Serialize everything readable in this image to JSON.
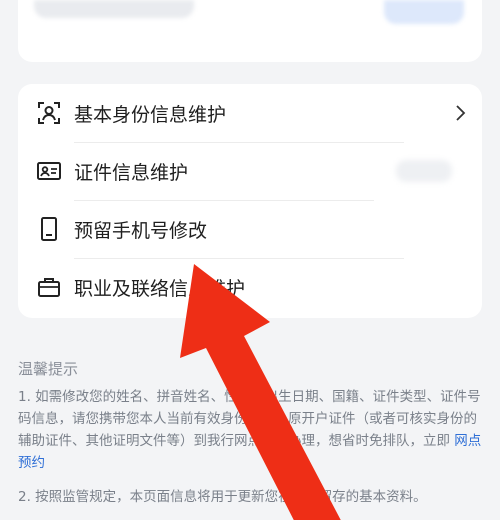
{
  "menu": {
    "items": [
      {
        "label": "基本身份信息维护",
        "icon": "id-person-icon"
      },
      {
        "label": "证件信息维护",
        "icon": "id-card-icon"
      },
      {
        "label": "预留手机号修改",
        "icon": "phone-icon"
      },
      {
        "label": "职业及联络信息维护",
        "icon": "briefcase-icon"
      }
    ]
  },
  "tips": {
    "title": "温馨提示",
    "p1_text": "1. 如需修改您的姓名、拼音姓名、性别、出生日期、国籍、证件类型、证件号码信息，请您携带您本人当前有效身份证件、原开户证件（或者可核实身份的辅助证件、其他证明文件等）到我行网点咨询办理，想省时免排队，立即",
    "p1_link": "网点预约",
    "p2_text": "2. 按照监管规定，本页面信息将用于更新您在我行留存的基本资料。"
  },
  "colors": {
    "arrow": "#ee2e16",
    "link": "#2f6fd6"
  }
}
